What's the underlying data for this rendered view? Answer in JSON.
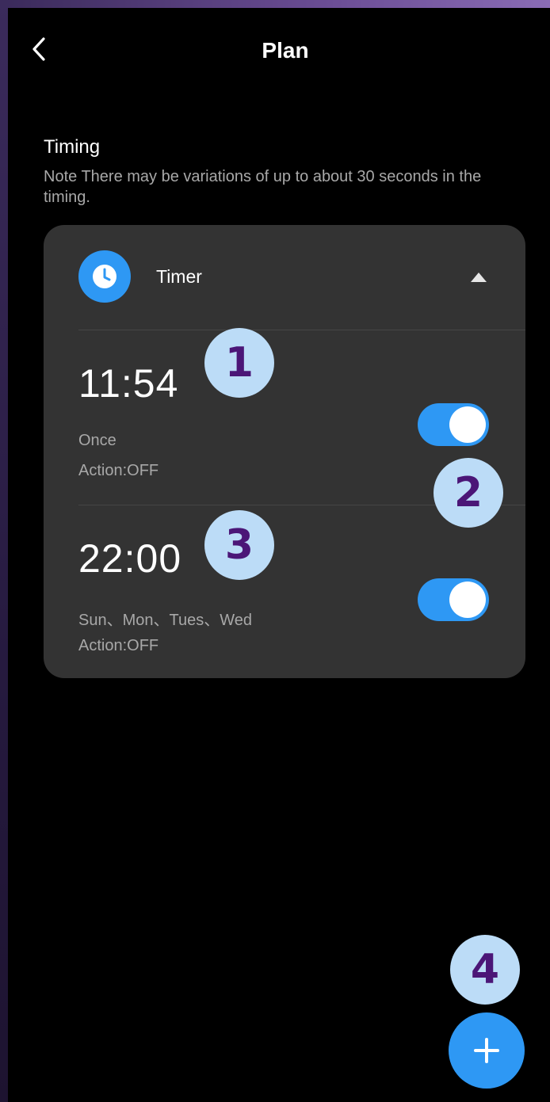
{
  "header": {
    "title": "Plan",
    "back_icon": "chevron-left-icon"
  },
  "section": {
    "title": "Timing",
    "note": "Note There may be variations of up to about 30 seconds in the timing."
  },
  "timer_card": {
    "label": "Timer",
    "icon": "clock-icon",
    "expanded": true,
    "items": [
      {
        "time": "11:54",
        "repeat": "Once",
        "action": "Action:OFF",
        "enabled": true
      },
      {
        "time": "22:00",
        "repeat": "Sun、Mon、Tues、Wed",
        "action": "Action:OFF",
        "enabled": true
      }
    ]
  },
  "annotations": [
    "1",
    "2",
    "3",
    "4"
  ],
  "fab": {
    "icon": "plus-icon"
  },
  "colors": {
    "accent": "#2e98f4",
    "card_bg": "#333333",
    "background": "#000000",
    "badge_bg": "#bcdcf7",
    "badge_text": "#4b1677"
  }
}
